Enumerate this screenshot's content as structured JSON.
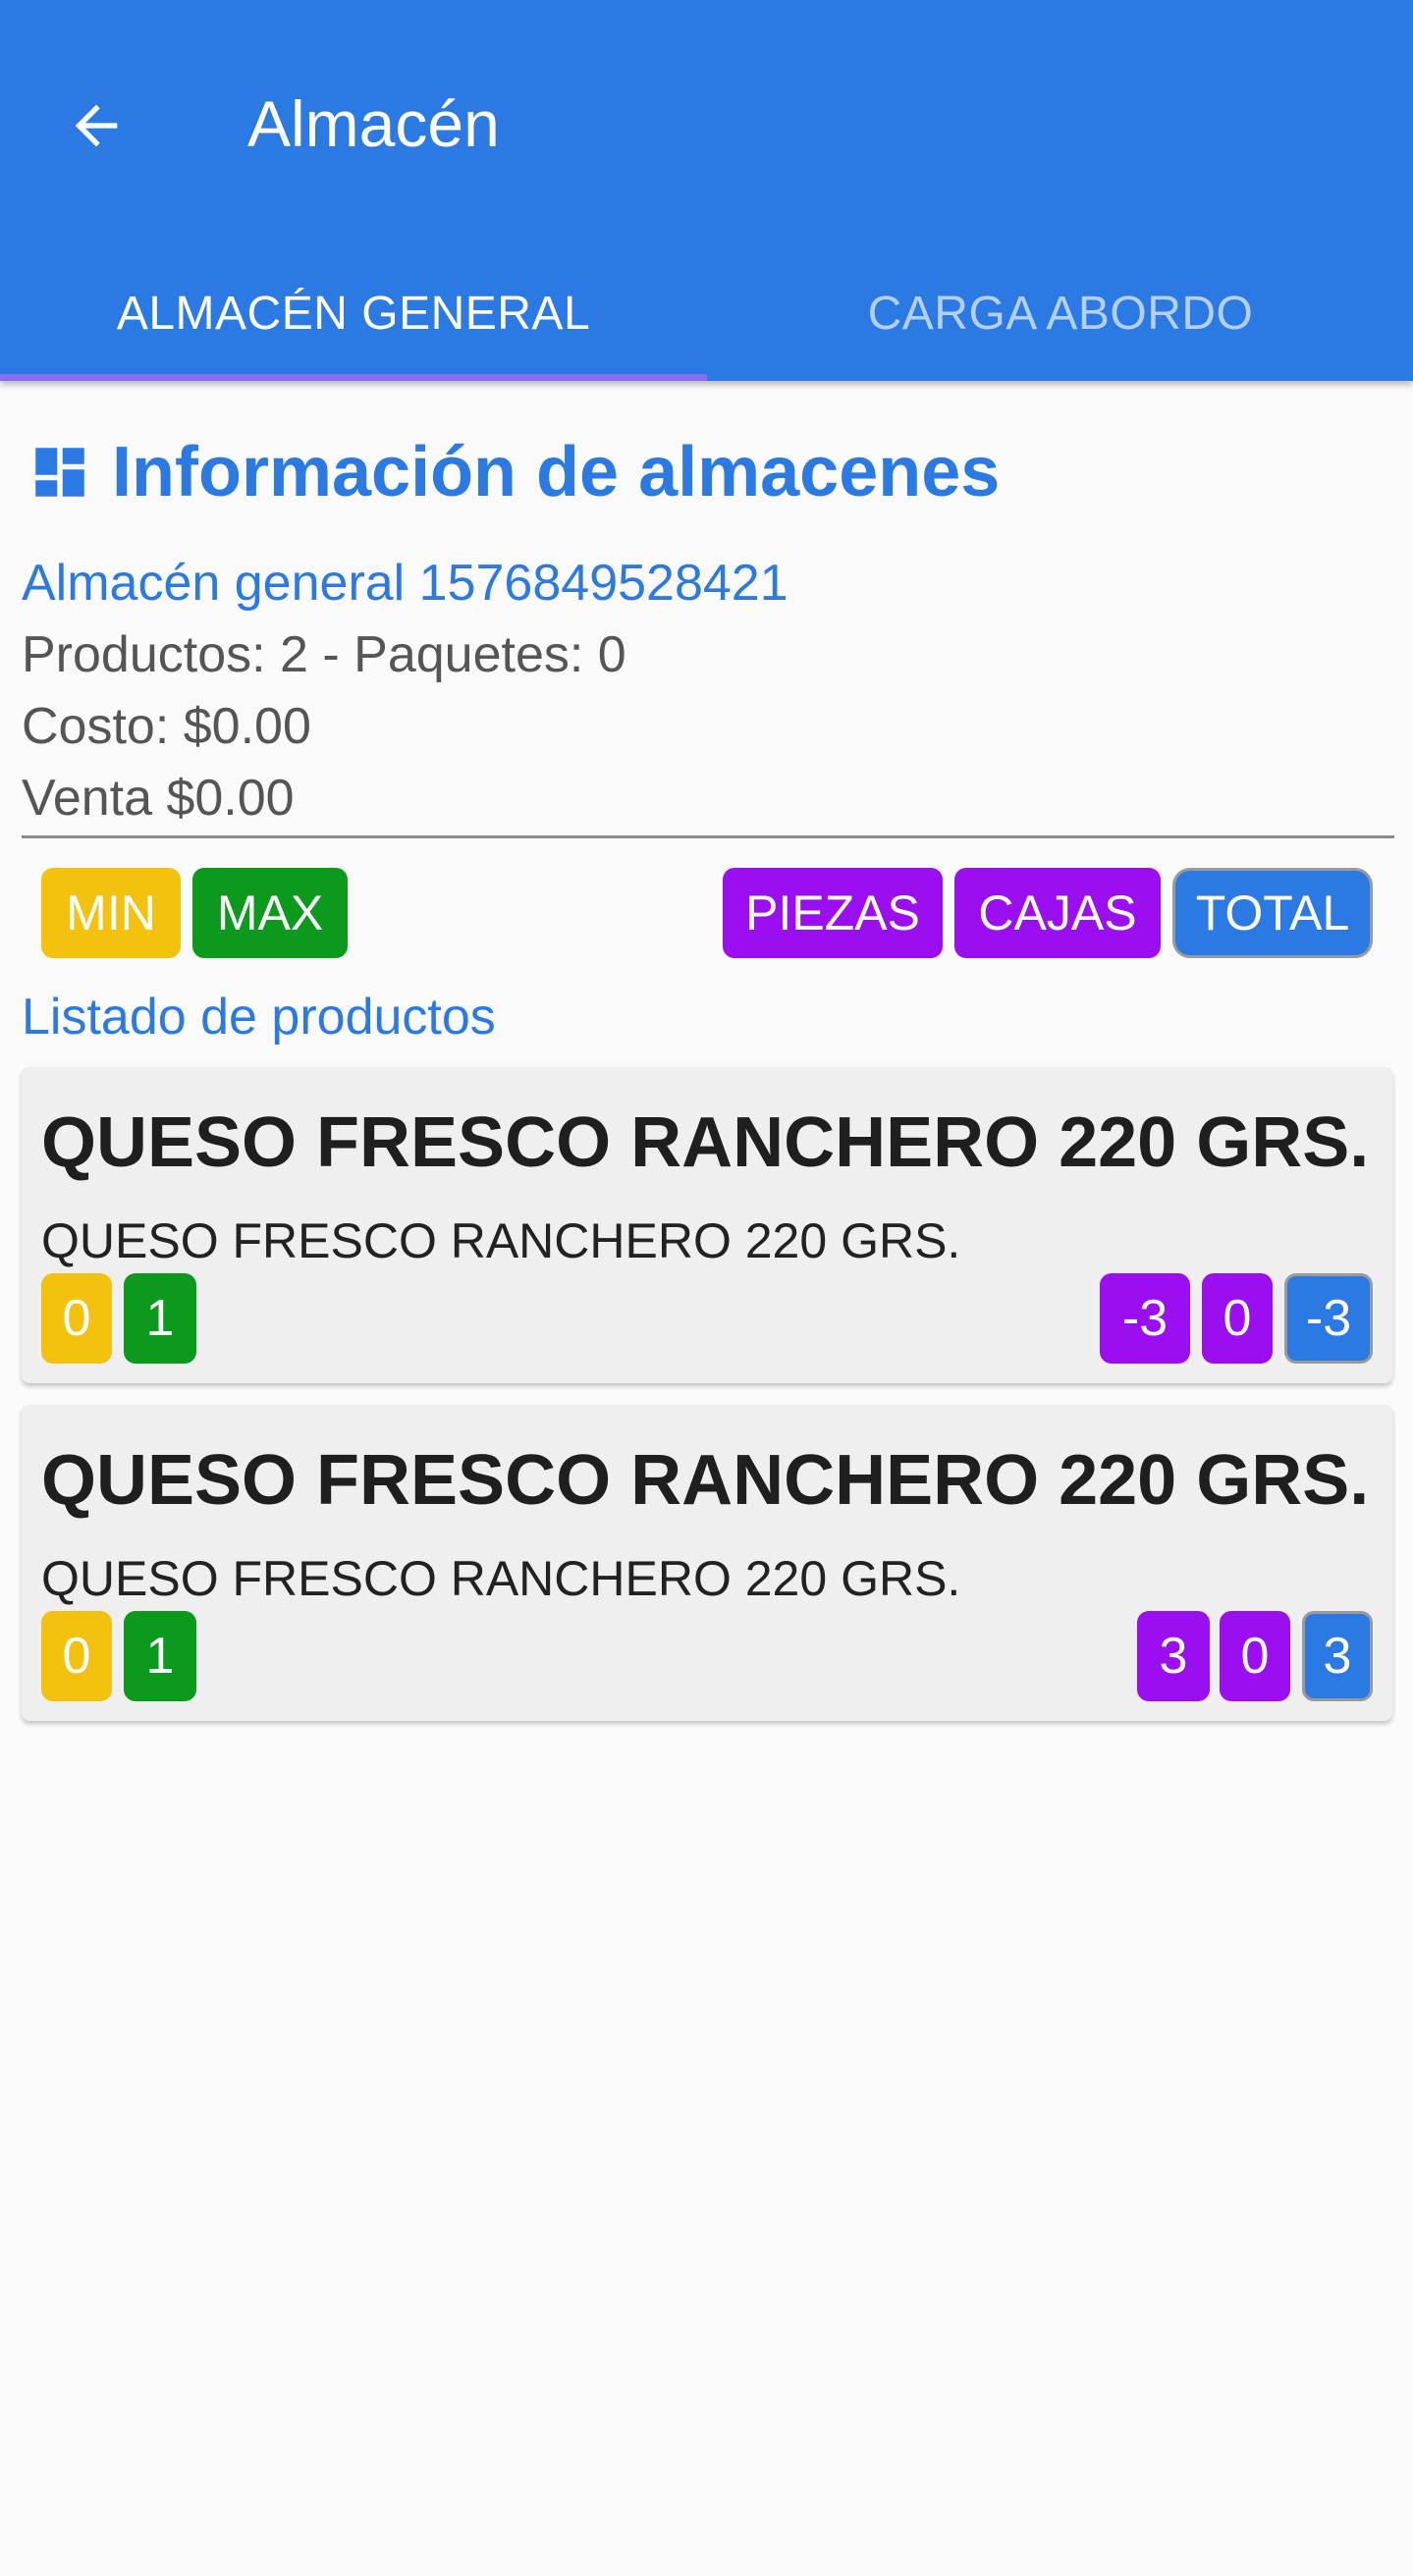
{
  "appbar": {
    "title": "Almacén",
    "tabs": [
      {
        "label": "ALMACÉN GENERAL",
        "active": true
      },
      {
        "label": "CARGA ABORDO",
        "active": false
      }
    ]
  },
  "colors": {
    "primary": "#2b7ae4",
    "min": "#f2c20f",
    "max": "#0b9a1c",
    "piezas": "#9a0ef0",
    "total": "#2b7ae4"
  },
  "info": {
    "title": "Información de almacenes",
    "icon": "dashboard-icon",
    "warehouse": "Almacén general 1576849528421",
    "products": "Productos: 2 - Paquetes: 0",
    "cost": "Costo: $0.00",
    "sale": "Venta $0.00"
  },
  "legend": {
    "min": "MIN",
    "max": "MAX",
    "piezas": "PIEZAS",
    "cajas": "CAJAS",
    "total": "TOTAL"
  },
  "list_title": "Listado de productos",
  "products": [
    {
      "name": "QUESO FRESCO RANCHERO 220 GRS.",
      "description": "QUESO FRESCO RANCHERO 220 GRS.",
      "min": "0",
      "max": "1",
      "piezas": "-3",
      "cajas": "0",
      "total": "-3"
    },
    {
      "name": "QUESO FRESCO RANCHERO 220 GRS.",
      "description": "QUESO FRESCO RANCHERO 220 GRS.",
      "min": "0",
      "max": "1",
      "piezas": "3",
      "cajas": "0",
      "total": "3"
    }
  ]
}
